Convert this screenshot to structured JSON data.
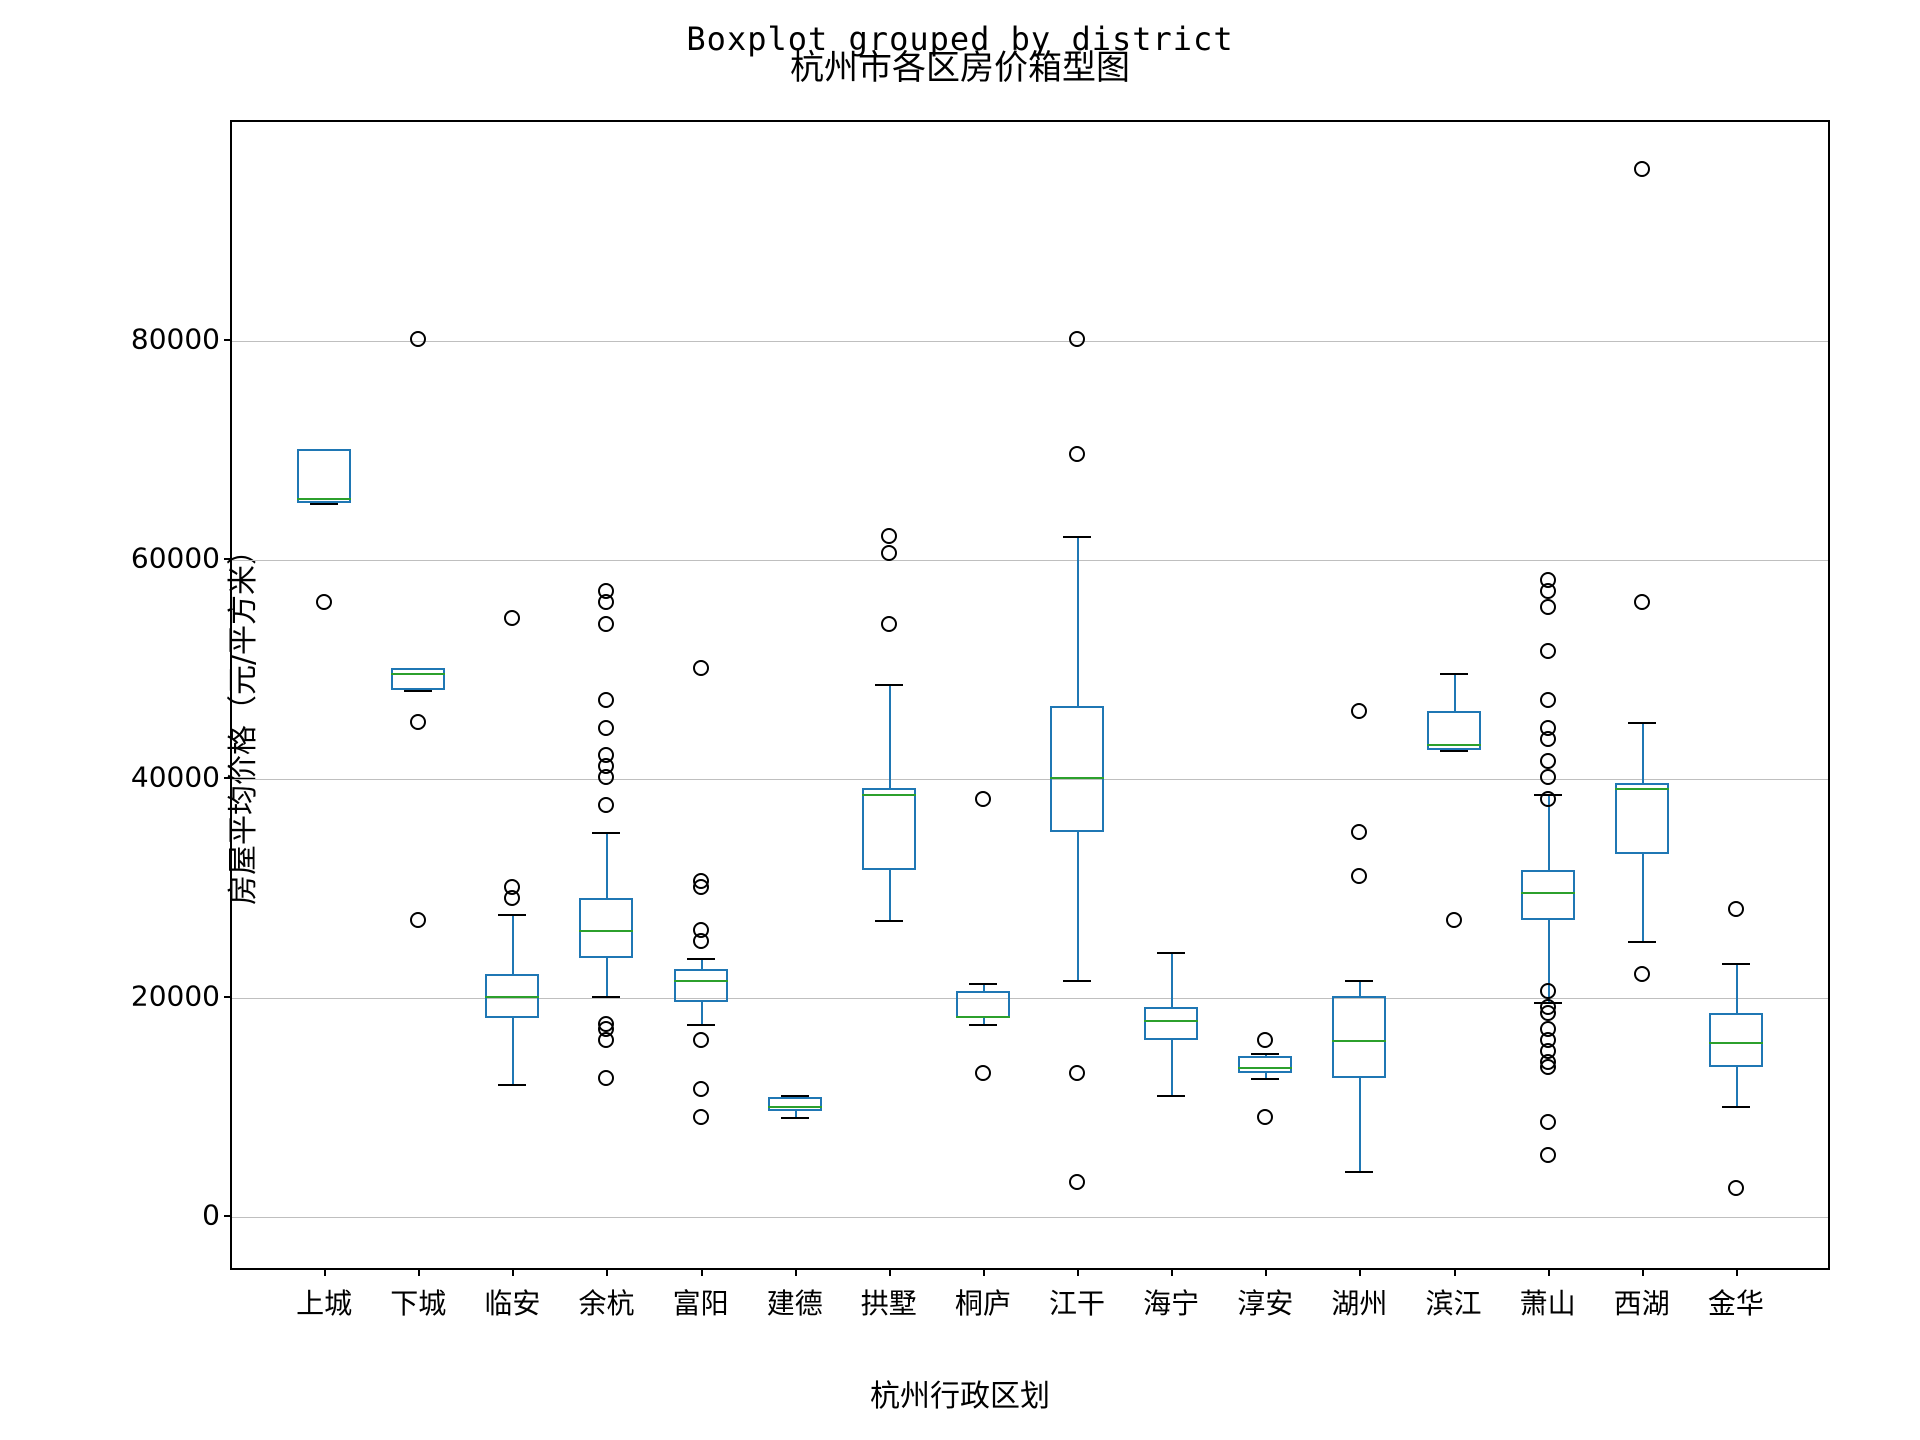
{
  "chart_data": {
    "type": "boxplot",
    "suptitle": "Boxplot grouped by district",
    "title": "杭州市各区房价箱型图",
    "xlabel": "杭州行政区划",
    "ylabel": "房屋平均价格（元/平方米）",
    "ylim": [
      -5000,
      100000
    ],
    "yticks": [
      0,
      20000,
      40000,
      60000,
      80000
    ],
    "categories": [
      "上城",
      "下城",
      "临安",
      "余杭",
      "富阳",
      "建德",
      "拱墅",
      "桐庐",
      "江干",
      "海宁",
      "淳安",
      "湖州",
      "滨江",
      "萧山",
      "西湖",
      "金华"
    ],
    "series": [
      {
        "name": "上城",
        "q1": 65000,
        "median": 65500,
        "q3": 70000,
        "whisker_low": 65000,
        "whisker_high": 70000,
        "outliers": [
          56000
        ]
      },
      {
        "name": "下城",
        "q1": 48000,
        "median": 49500,
        "q3": 50000,
        "whisker_low": 48000,
        "whisker_high": 50000,
        "outliers": [
          45000,
          27000,
          80000
        ]
      },
      {
        "name": "临安",
        "q1": 18000,
        "median": 20000,
        "q3": 22000,
        "whisker_low": 12000,
        "whisker_high": 27500,
        "outliers": [
          29000,
          30000,
          54500
        ]
      },
      {
        "name": "余杭",
        "q1": 23500,
        "median": 26000,
        "q3": 29000,
        "whisker_low": 20000,
        "whisker_high": 35000,
        "outliers": [
          12500,
          16000,
          17000,
          17500,
          37500,
          40000,
          41000,
          42000,
          44500,
          47000,
          54000,
          56000,
          57000
        ]
      },
      {
        "name": "富阳",
        "q1": 19500,
        "median": 21500,
        "q3": 22500,
        "whisker_low": 17500,
        "whisker_high": 23500,
        "outliers": [
          9000,
          11500,
          16000,
          25000,
          26000,
          30000,
          30500,
          50000
        ]
      },
      {
        "name": "建德",
        "q1": 9500,
        "median": 10000,
        "q3": 10800,
        "whisker_low": 9000,
        "whisker_high": 11000,
        "outliers": []
      },
      {
        "name": "拱墅",
        "q1": 31500,
        "median": 38500,
        "q3": 39000,
        "whisker_low": 27000,
        "whisker_high": 48500,
        "outliers": [
          54000,
          60500,
          62000
        ]
      },
      {
        "name": "桐庐",
        "q1": 18000,
        "median": 18200,
        "q3": 20500,
        "whisker_low": 17500,
        "whisker_high": 21200,
        "outliers": [
          13000,
          38000
        ]
      },
      {
        "name": "江干",
        "q1": 35000,
        "median": 40000,
        "q3": 46500,
        "whisker_low": 21500,
        "whisker_high": 62000,
        "outliers": [
          3000,
          13000,
          69500,
          80000
        ]
      },
      {
        "name": "海宁",
        "q1": 16000,
        "median": 17800,
        "q3": 19000,
        "whisker_low": 11000,
        "whisker_high": 24000,
        "outliers": []
      },
      {
        "name": "淳安",
        "q1": 13000,
        "median": 13500,
        "q3": 14500,
        "whisker_low": 12500,
        "whisker_high": 14800,
        "outliers": [
          9000,
          16000
        ]
      },
      {
        "name": "湖州",
        "q1": 12500,
        "median": 16000,
        "q3": 20000,
        "whisker_low": 4000,
        "whisker_high": 21500,
        "outliers": [
          31000,
          35000,
          46000
        ]
      },
      {
        "name": "滨江",
        "q1": 42500,
        "median": 43000,
        "q3": 46000,
        "whisker_low": 42500,
        "whisker_high": 49500,
        "outliers": [
          27000
        ]
      },
      {
        "name": "萧山",
        "q1": 27000,
        "median": 29500,
        "q3": 31500,
        "whisker_low": 19500,
        "whisker_high": 38500,
        "outliers": [
          5500,
          8500,
          13500,
          14000,
          15000,
          16000,
          17000,
          18500,
          19000,
          20500,
          38000,
          40000,
          41500,
          43500,
          44500,
          47000,
          51500,
          55500,
          57000,
          58000
        ]
      },
      {
        "name": "西湖",
        "q1": 33000,
        "median": 39000,
        "q3": 39500,
        "whisker_low": 25000,
        "whisker_high": 45000,
        "outliers": [
          22000,
          56000,
          95500
        ]
      },
      {
        "name": "金华",
        "q1": 13500,
        "median": 15800,
        "q3": 18500,
        "whisker_low": 10000,
        "whisker_high": 23000,
        "outliers": [
          2500,
          28000
        ]
      }
    ]
  },
  "watermark": ""
}
